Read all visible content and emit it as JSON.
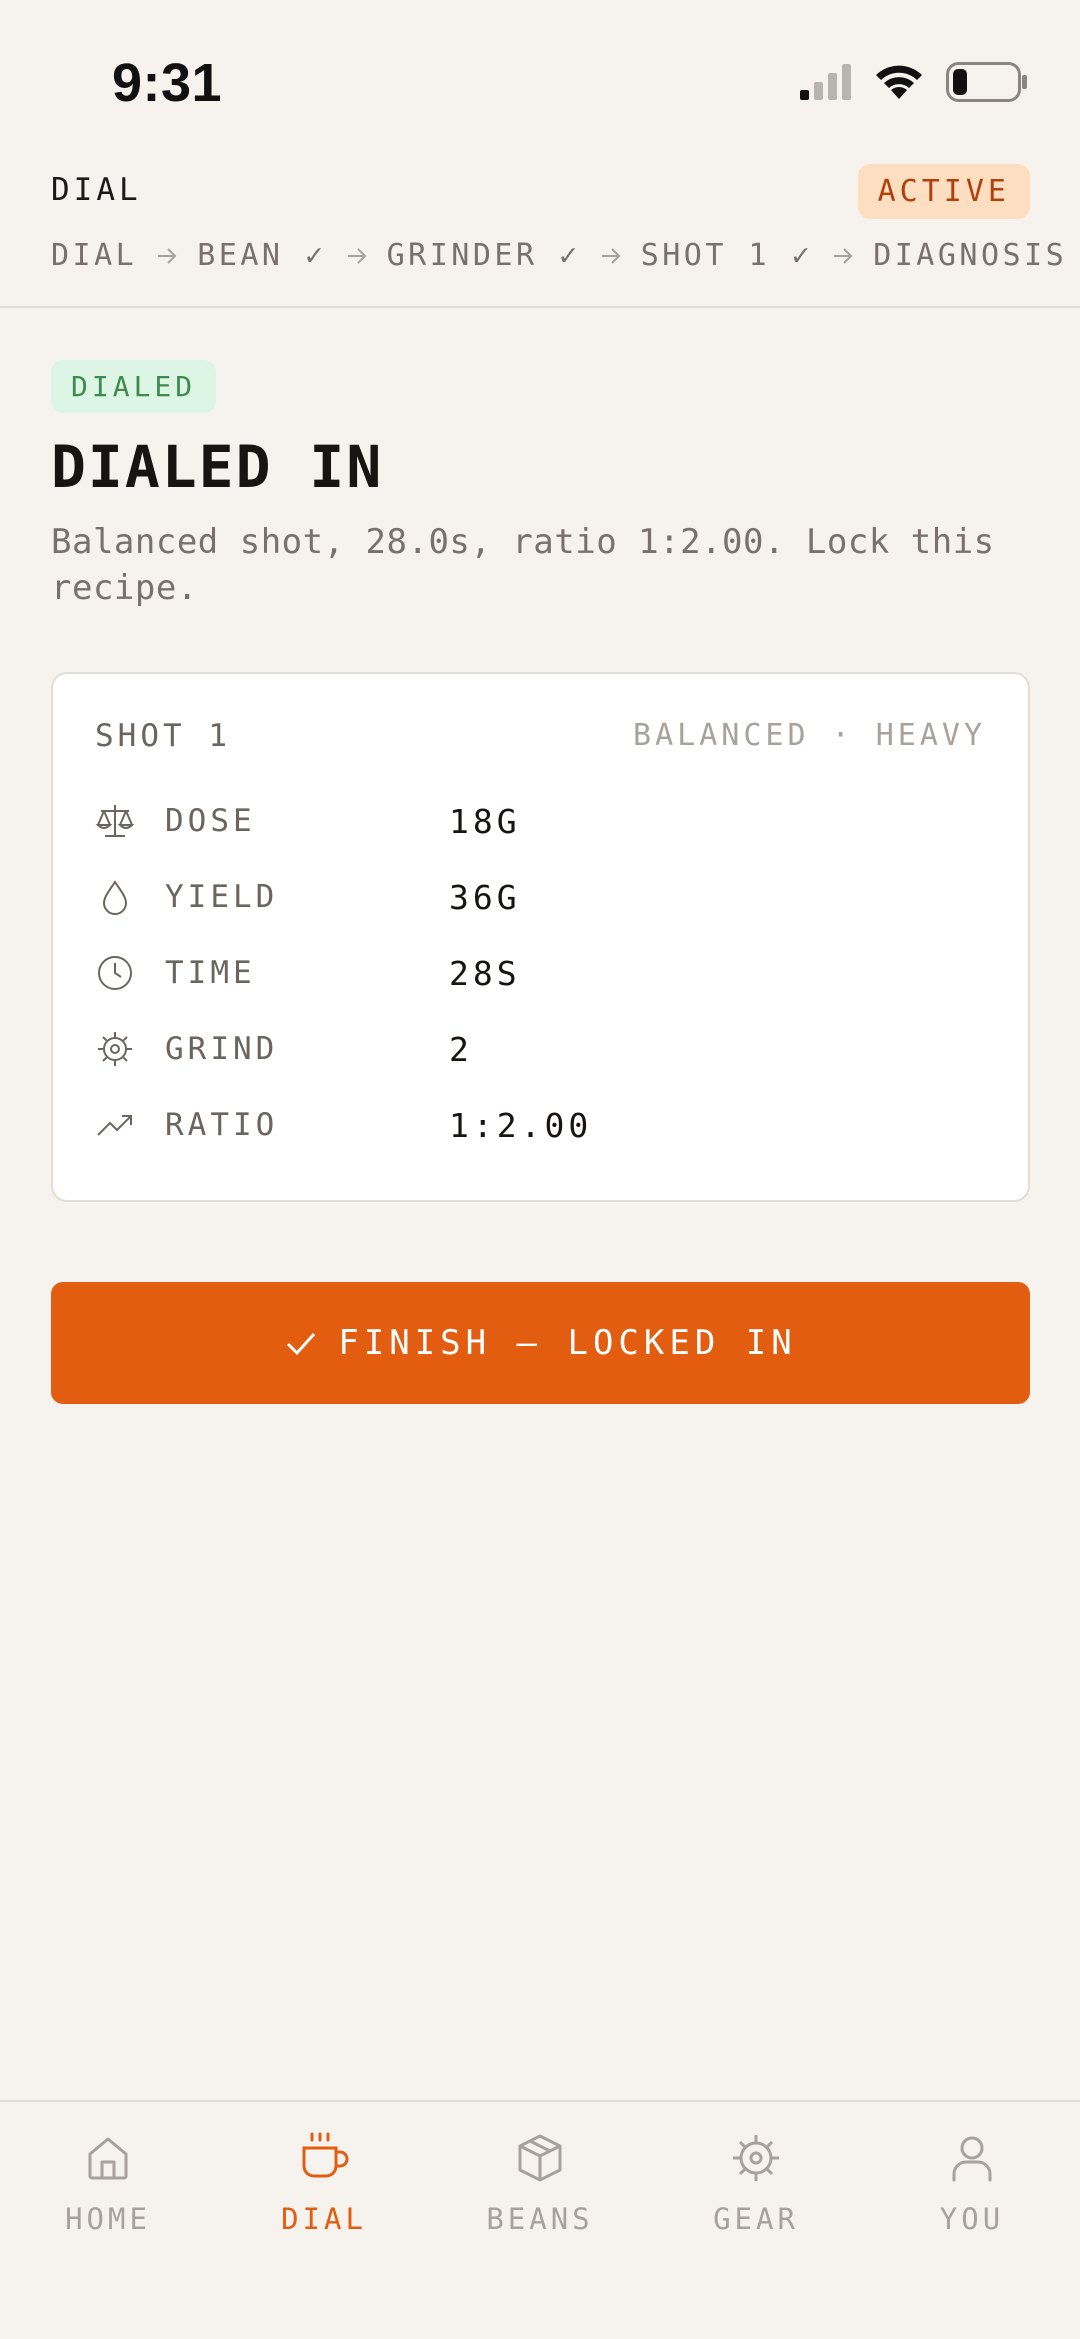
{
  "status_bar": {
    "time": "9:31"
  },
  "header": {
    "title": "DIAL",
    "badge": "ACTIVE",
    "breadcrumb": [
      "DIAL",
      "BEAN ✓",
      "GRINDER ✓",
      "SHOT 1 ✓",
      "DIAGNOSIS"
    ]
  },
  "result": {
    "badge": "DIALED",
    "title": "DIALED IN",
    "subtitle": "Balanced shot, 28.0s, ratio 1:2.00. Lock this recipe."
  },
  "shot_card": {
    "title": "SHOT 1",
    "tags": "BALANCED · HEAVY",
    "stats": [
      {
        "icon": "scale-icon",
        "label": "DOSE",
        "value": "18G"
      },
      {
        "icon": "drop-icon",
        "label": "YIELD",
        "value": "36G"
      },
      {
        "icon": "clock-icon",
        "label": "TIME",
        "value": "28S"
      },
      {
        "icon": "gear-icon",
        "label": "GRIND",
        "value": "2"
      },
      {
        "icon": "trend-up-icon",
        "label": "RATIO",
        "value": "1:2.00"
      }
    ]
  },
  "finish_button": {
    "label": "FINISH — LOCKED IN",
    "icon": "check-icon"
  },
  "tabs": [
    {
      "label": "HOME",
      "icon": "home-icon",
      "active": false
    },
    {
      "label": "DIAL",
      "icon": "cup-icon",
      "active": true
    },
    {
      "label": "BEANS",
      "icon": "box-icon",
      "active": false
    },
    {
      "label": "GEAR",
      "icon": "gear-icon",
      "active": false
    },
    {
      "label": "YOU",
      "icon": "user-icon",
      "active": false
    }
  ],
  "colors": {
    "accent": "#e25d0f",
    "background": "#f6f3ef",
    "active_badge_bg": "#fedec0",
    "active_badge_text": "#b2400d",
    "dialed_badge_bg": "#dcf5e4",
    "dialed_badge_text": "#3f8a4f",
    "muted_text": "#78716c"
  }
}
